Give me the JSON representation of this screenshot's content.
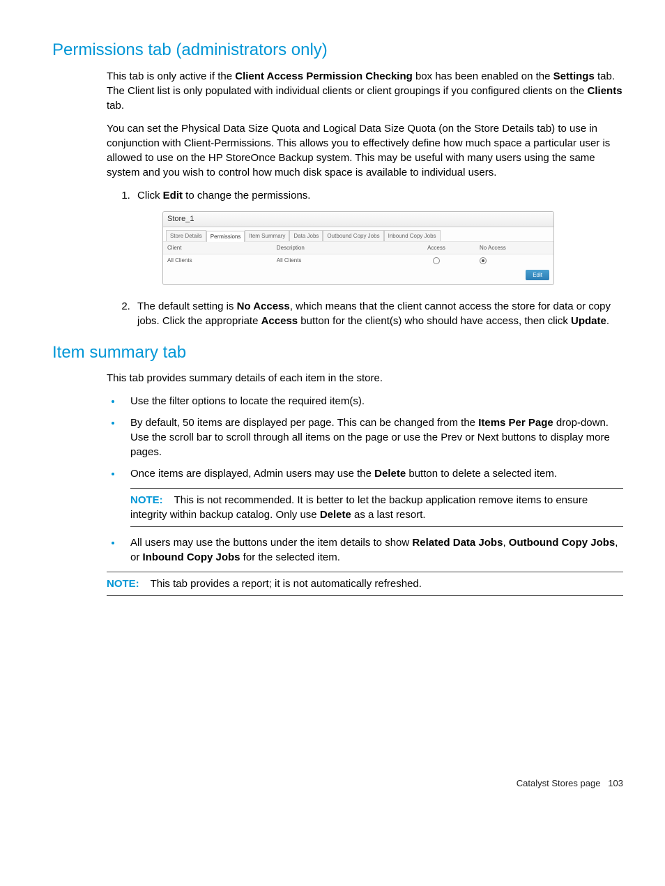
{
  "heading1": "Permissions tab (administrators only)",
  "para1_a": "This tab is only active if the ",
  "para1_b": "Client Access Permission Checking",
  "para1_c": " box has been enabled on the ",
  "para1_d": "Settings",
  "para1_e": " tab. The Client list is only populated with individual clients or client groupings if you configured clients on the ",
  "para1_f": "Clients",
  "para1_g": " tab.",
  "para2": "You can set the Physical Data Size Quota and Logical Data Size Quota (on the Store Details tab) to use in conjunction with Client-Permissions. This allows you to effectively define how much space a particular user is allowed to use on the HP StoreOnce Backup system. This may be useful with many users using the same system and you wish to control how much disk space is available to individual users.",
  "step1_a": "Click ",
  "step1_b": "Edit",
  "step1_c": " to change the permissions.",
  "panel": {
    "title": "Store_1",
    "tabs": [
      "Store Details",
      "Permissions",
      "Item Summary",
      "Data Jobs",
      "Outbound Copy Jobs",
      "Inbound Copy Jobs"
    ],
    "headers": [
      "Client",
      "Description",
      "Access",
      "No Access"
    ],
    "row_client": "All Clients",
    "row_desc": "All Clients",
    "edit": "Edit"
  },
  "step2_a": "The default setting is ",
  "step2_b": "No Access",
  "step2_c": ", which means that the client cannot access the store for data or copy jobs. Click the appropriate ",
  "step2_d": "Access",
  "step2_e": " button for the client(s) who should have access, then click ",
  "step2_f": "Update",
  "step2_g": ".",
  "heading2": "Item summary tab",
  "para3": "This tab provides summary details of each item in the store.",
  "bullet1": "Use the filter options to locate the required item(s).",
  "bullet2_a": "By default, 50 items are displayed per page. This can be changed from the ",
  "bullet2_b": "Items Per Page",
  "bullet2_c": " drop-down. Use the scroll bar to scroll through all items on the page or use the Prev or Next buttons to display more pages.",
  "bullet3_a": "Once items are displayed, Admin users may use the ",
  "bullet3_b": "Delete",
  "bullet3_c": " button to delete a selected item.",
  "note_label": "NOTE:",
  "note1_a": "This is not recommended. It is better to let the backup application remove items to ensure integrity within backup catalog. Only use ",
  "note1_b": "Delete",
  "note1_c": " as a last resort.",
  "bullet4_a": "All users may use the buttons under the item details to show ",
  "bullet4_b": "Related Data Jobs",
  "bullet4_c": ", ",
  "bullet4_d": "Outbound Copy Jobs",
  "bullet4_e": ", or ",
  "bullet4_f": "Inbound Copy Jobs",
  "bullet4_g": " for the selected item.",
  "note2": "This tab provides a report; it is not automatically refreshed.",
  "footer_text": "Catalyst Stores page",
  "footer_num": "103"
}
